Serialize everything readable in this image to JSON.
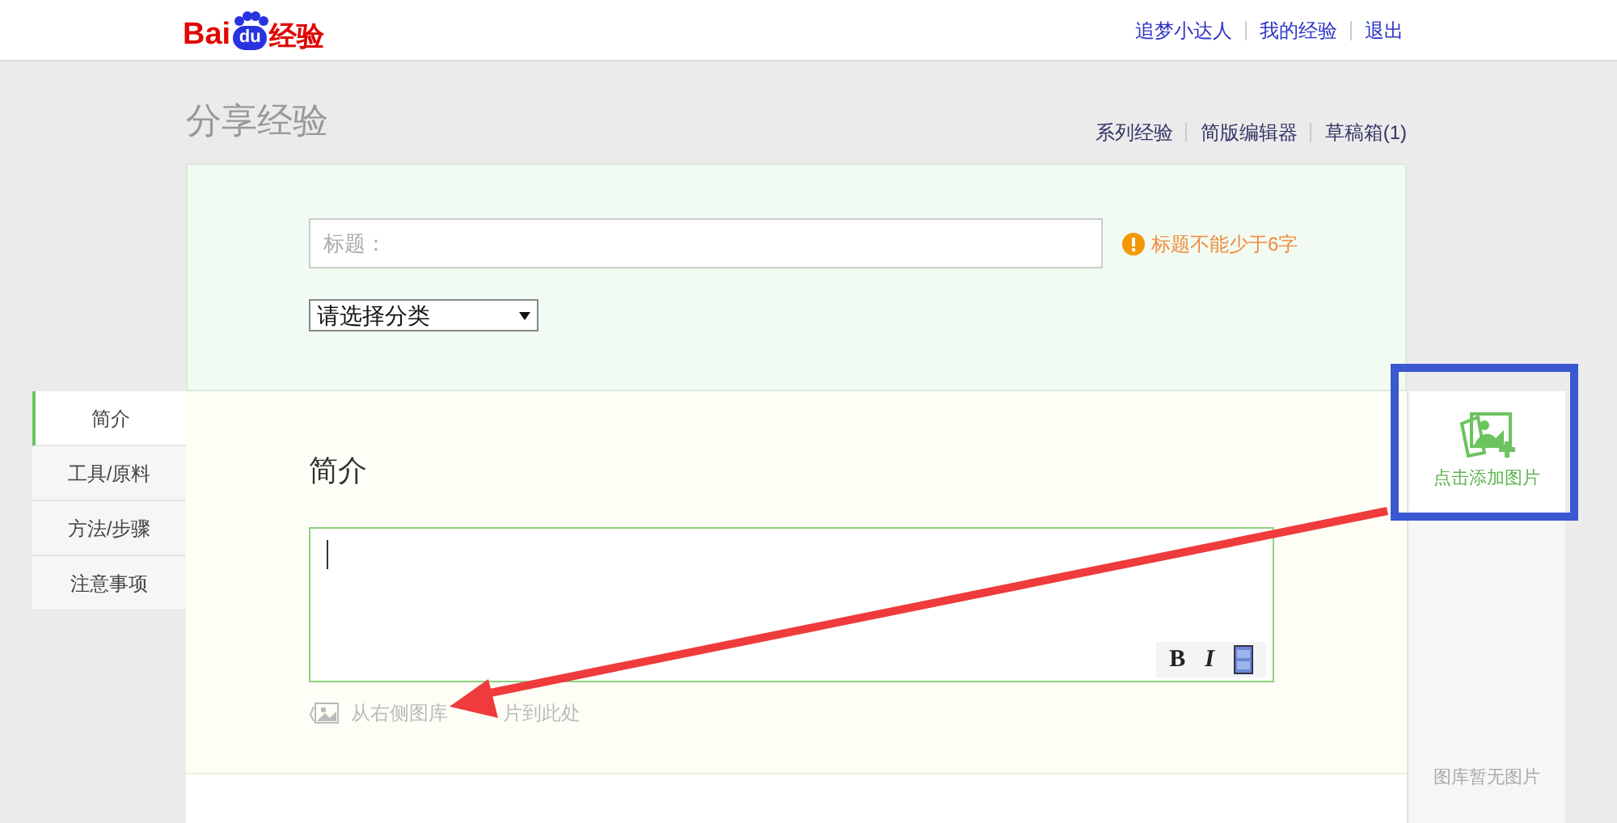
{
  "header": {
    "logo": {
      "left": "Bai",
      "badge": "du",
      "right": "经验"
    },
    "user_links": [
      "追梦小达人",
      "我的经验",
      "退出"
    ]
  },
  "page": {
    "title": "分享经验",
    "links": [
      "系列经验",
      "简版编辑器",
      "草稿箱(1)"
    ]
  },
  "form": {
    "title_field": {
      "placeholder": "标题："
    },
    "warning": "标题不能少于6字",
    "category": {
      "value": "请选择分类"
    }
  },
  "sections": [
    {
      "label": "简介",
      "selected": true
    },
    {
      "label": "工具/原料",
      "selected": false
    },
    {
      "label": "方法/步骤",
      "selected": false
    },
    {
      "label": "注意事项",
      "selected": false
    }
  ],
  "editor": {
    "heading": "简介",
    "toolbar": [
      {
        "kind": "bold",
        "label": "B"
      },
      {
        "kind": "italic",
        "label": "I"
      },
      {
        "kind": "video"
      }
    ],
    "drop_hint": [
      "从右侧图库",
      "片到此处"
    ]
  },
  "gallery": {
    "add_label": "点击添加图片",
    "empty_text": "图库暂无图片"
  }
}
